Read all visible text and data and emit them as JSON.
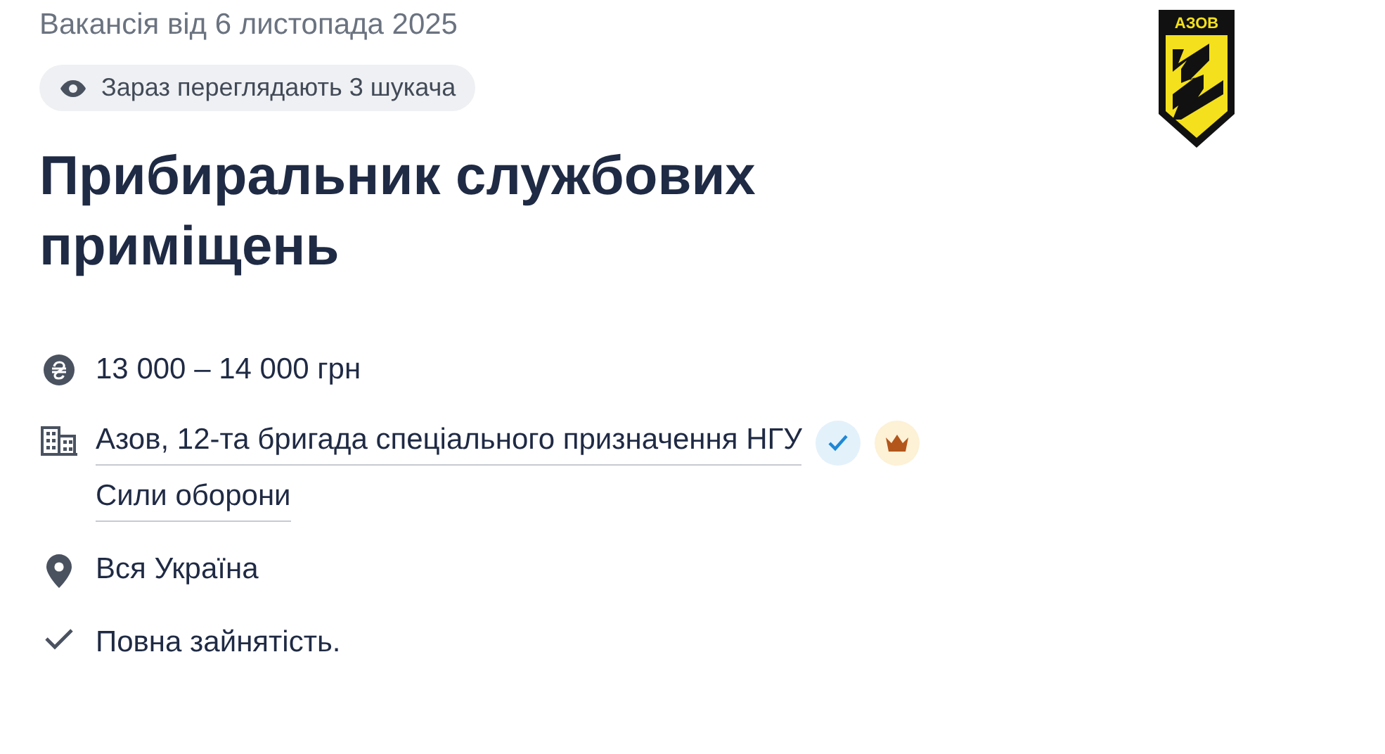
{
  "posted": "Вакансія від 6 листопада 2025",
  "viewers_badge": "Зараз переглядають 3 шукача",
  "title": "Прибиральник службових приміщень",
  "salary": "13 000 – 14 000 грн",
  "company": {
    "name": "Азов, 12-та бригада спеціального призначення НГУ",
    "verified": true,
    "premium": true
  },
  "category": "Сили оборони",
  "location": "Вся Україна",
  "employment": "Повна зайнятість.",
  "logo": {
    "text": "АЗОВ"
  }
}
